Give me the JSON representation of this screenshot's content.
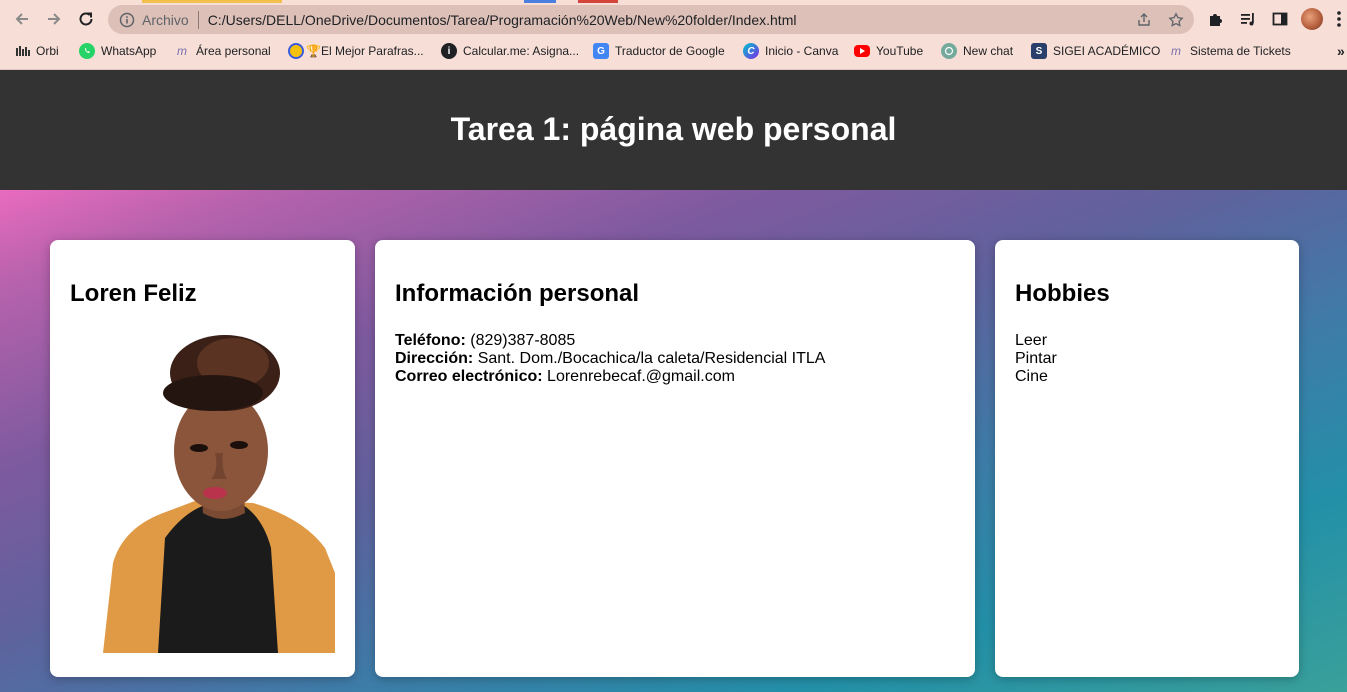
{
  "browser": {
    "address": {
      "chip": "Archivo",
      "url": "C:/Users/DELL/OneDrive/Documentos/Tarea/Programación%20Web/New%20folder/Index.html"
    },
    "bookmarks": [
      {
        "label": "Orbi",
        "icon": "orbi-icon"
      },
      {
        "label": "WhatsApp",
        "icon": "whatsapp-icon"
      },
      {
        "label": "Área personal",
        "icon": "moodle-icon"
      },
      {
        "label": "🏆El Mejor Parafras...",
        "icon": "parafraseador-icon"
      },
      {
        "label": "Calcular.me: Asigna...",
        "icon": "info-icon"
      },
      {
        "label": "Traductor de Google",
        "icon": "google-translate-icon"
      },
      {
        "label": "Inicio - Canva",
        "icon": "canva-icon"
      },
      {
        "label": "YouTube",
        "icon": "youtube-icon"
      },
      {
        "label": "New chat",
        "icon": "chatgpt-icon"
      },
      {
        "label": "SIGEI ACADÉMICO",
        "icon": "sigei-icon"
      },
      {
        "label": "Sistema de Tickets",
        "icon": "moodle-icon"
      }
    ],
    "overflow": "»"
  },
  "page": {
    "title": "Tarea 1: página web personal",
    "profile": {
      "name": "Loren Feliz",
      "photo_alt": "Loren Feliz"
    },
    "info": {
      "heading": "Información personal",
      "phone_label": "Teléfono:",
      "phone": "(829)387-8085",
      "address_label": "Dirección:",
      "address": "Sant. Dom./Bocachica/la caleta/Residencial ITLA",
      "email_label": "Correo electrónico:",
      "email": "Lorenrebecaf.@gmail.com"
    },
    "hobbies": {
      "heading": "Hobbies",
      "items": [
        "Leer",
        "Pintar",
        "Cine"
      ]
    }
  },
  "colors": {
    "chrome_bg": "#f7ded6",
    "omnibox_bg": "#ddc1b9",
    "header_bg": "#333333",
    "gradient_start": "#e96bbf",
    "gradient_end": "#3aa09a"
  }
}
